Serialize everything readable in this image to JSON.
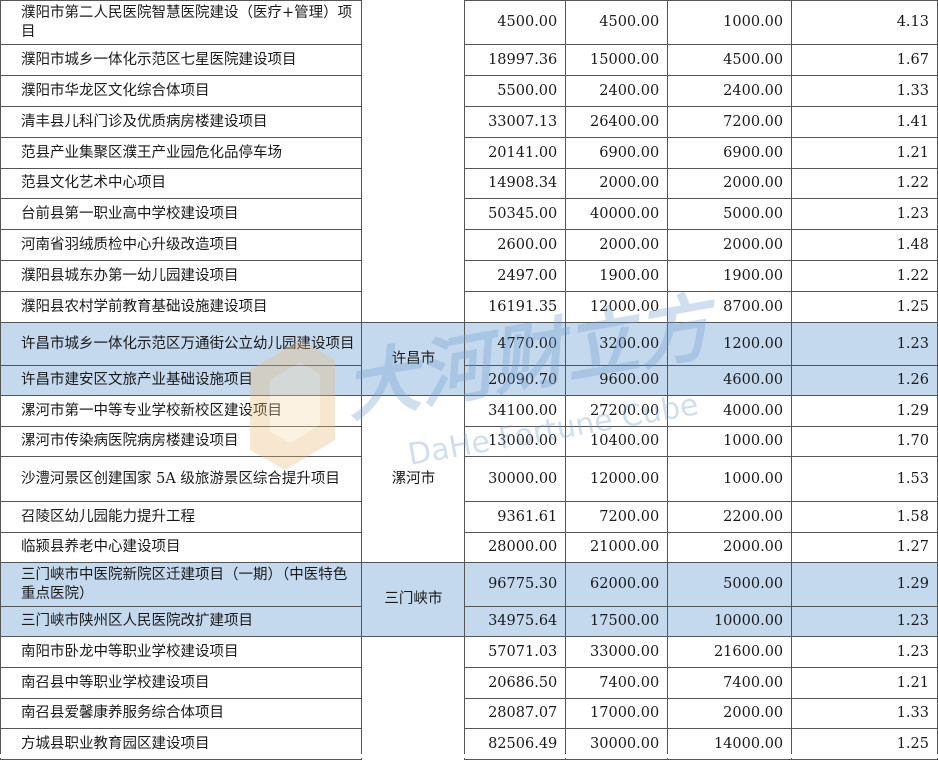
{
  "table": {
    "rows": [
      {
        "name": "濮阳市第二人民医院智慧医院建设（医疗+管理）项目",
        "city": "",
        "v1": "4500.00",
        "v2": "4500.00",
        "v3": "1000.00",
        "ratio": "4.13",
        "hl": false
      },
      {
        "name": "濮阳市城乡一体化示范区七星医院建设项目",
        "city": "",
        "v1": "18997.36",
        "v2": "15000.00",
        "v3": "4500.00",
        "ratio": "1.67",
        "hl": false
      },
      {
        "name": "濮阳市华龙区文化综合体项目",
        "city": "",
        "v1": "5500.00",
        "v2": "2400.00",
        "v3": "2400.00",
        "ratio": "1.33",
        "hl": false
      },
      {
        "name": "清丰县儿科门诊及优质病房楼建设项目",
        "city": "",
        "v1": "33007.13",
        "v2": "26400.00",
        "v3": "7200.00",
        "ratio": "1.41",
        "hl": false
      },
      {
        "name": "范县产业集聚区濮王产业园危化品停车场",
        "city": "",
        "v1": "20141.00",
        "v2": "6900.00",
        "v3": "6900.00",
        "ratio": "1.21",
        "hl": false
      },
      {
        "name": "范县文化艺术中心项目",
        "city": "",
        "v1": "14908.34",
        "v2": "2000.00",
        "v3": "2000.00",
        "ratio": "1.22",
        "hl": false
      },
      {
        "name": "台前县第一职业高中学校建设项目",
        "city": "",
        "v1": "50345.00",
        "v2": "40000.00",
        "v3": "5000.00",
        "ratio": "1.23",
        "hl": false
      },
      {
        "name": "河南省羽绒质检中心升级改造项目",
        "city": "",
        "v1": "2600.00",
        "v2": "2000.00",
        "v3": "2000.00",
        "ratio": "1.48",
        "hl": false
      },
      {
        "name": "濮阳县城东办第一幼儿园建设项目",
        "city": "",
        "v1": "2497.00",
        "v2": "1900.00",
        "v3": "1900.00",
        "ratio": "1.22",
        "hl": false
      },
      {
        "name": "濮阳县农村学前教育基础设施建设项目",
        "city": "",
        "v1": "16191.35",
        "v2": "12000.00",
        "v3": "8700.00",
        "ratio": "1.25",
        "hl": false
      },
      {
        "name": "许昌市城乡一体化示范区万通街公立幼儿园建设项目",
        "city": "许昌市",
        "v1": "4770.00",
        "v2": "3200.00",
        "v3": "1200.00",
        "ratio": "1.23",
        "hl": true
      },
      {
        "name": "许昌市建安区文旅产业基础设施项目",
        "city": "",
        "v1": "20090.70",
        "v2": "9600.00",
        "v3": "4600.00",
        "ratio": "1.26",
        "hl": true
      },
      {
        "name": "漯河市第一中等专业学校新校区建设项目",
        "city": "漯河市",
        "v1": "34100.00",
        "v2": "27200.00",
        "v3": "4000.00",
        "ratio": "1.29",
        "hl": false
      },
      {
        "name": "漯河市传染病医院病房楼建设项目",
        "city": "",
        "v1": "13000.00",
        "v2": "10400.00",
        "v3": "1000.00",
        "ratio": "1.70",
        "hl": false
      },
      {
        "name": "沙澧河景区创建国家 5A 级旅游景区综合提升项目",
        "city": "",
        "v1": "30000.00",
        "v2": "12000.00",
        "v3": "1000.00",
        "ratio": "1.53",
        "hl": false
      },
      {
        "name": "召陵区幼儿园能力提升工程",
        "city": "",
        "v1": "9361.61",
        "v2": "7200.00",
        "v3": "2200.00",
        "ratio": "1.58",
        "hl": false
      },
      {
        "name": "临颍县养老中心建设项目",
        "city": "",
        "v1": "28000.00",
        "v2": "21000.00",
        "v3": "2000.00",
        "ratio": "1.27",
        "hl": false
      },
      {
        "name": "三门峡市中医院新院区迁建项目（一期）（中医特色重点医院）",
        "city": "三门峡市",
        "v1": "96775.30",
        "v2": "62000.00",
        "v3": "5000.00",
        "ratio": "1.29",
        "hl": true
      },
      {
        "name": "三门峡市陕州区人民医院改扩建项目",
        "city": "",
        "v1": "34975.64",
        "v2": "17500.00",
        "v3": "10000.00",
        "ratio": "1.23",
        "hl": true
      },
      {
        "name": "南阳市卧龙中等职业学校建设项目",
        "city": "",
        "v1": "57071.03",
        "v2": "33000.00",
        "v3": "21600.00",
        "ratio": "1.23",
        "hl": false
      },
      {
        "name": "南召县中等职业学校建设项目",
        "city": "",
        "v1": "20686.50",
        "v2": "7400.00",
        "v3": "7400.00",
        "ratio": "1.21",
        "hl": false
      },
      {
        "name": "南召县爱馨康养服务综合体项目",
        "city": "",
        "v1": "28087.07",
        "v2": "17000.00",
        "v3": "2000.00",
        "ratio": "1.33",
        "hl": false
      },
      {
        "name": "方城县职业教育园区建设项目",
        "city": "",
        "v1": "82506.49",
        "v2": "30000.00",
        "v3": "14000.00",
        "ratio": "1.25",
        "hl": false
      }
    ]
  },
  "watermark": {
    "cn_text": "大河财立方",
    "en_text": "DaHe Fortune Cube",
    "color": "#6f9ed0"
  }
}
